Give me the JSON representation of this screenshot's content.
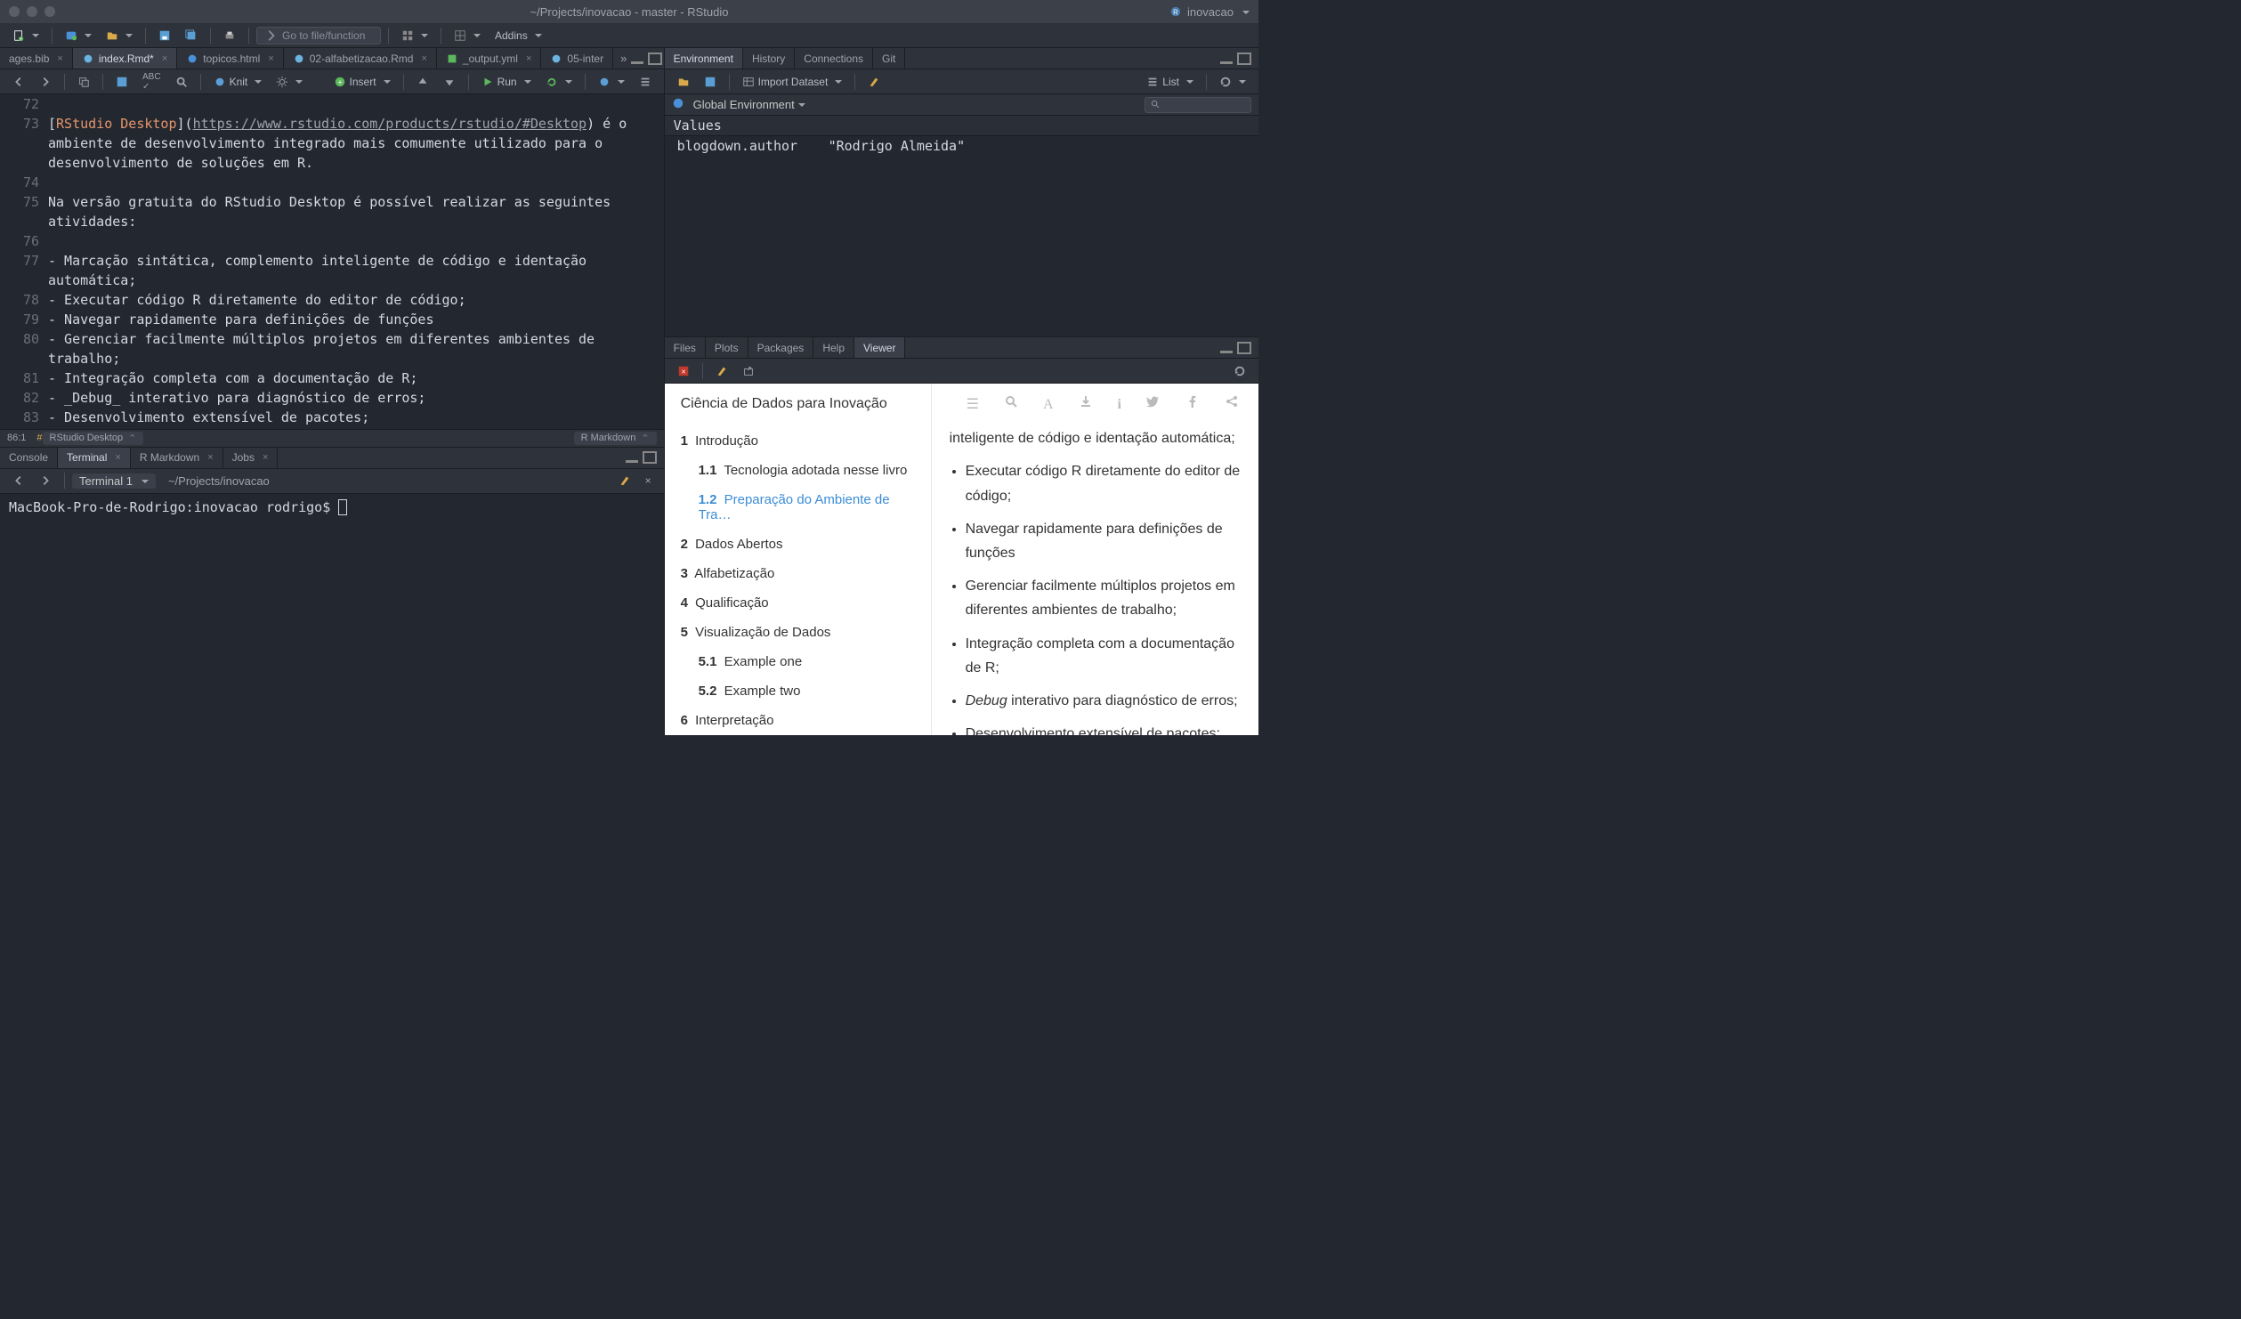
{
  "window": {
    "title": "~/Projects/inovacao - master - RStudio",
    "project": "inovacao"
  },
  "main_toolbar": {
    "goto_placeholder": "Go to file/function",
    "addins": "Addins"
  },
  "source": {
    "tabs": [
      {
        "label": "ages.bib"
      },
      {
        "label": "index.Rmd*"
      },
      {
        "label": "topicos.html"
      },
      {
        "label": "02-alfabetizacao.Rmd"
      },
      {
        "label": "_output.yml"
      },
      {
        "label": "05-inter"
      }
    ],
    "toolbar": {
      "knit": "Knit",
      "insert": "Insert",
      "run": "Run"
    },
    "code": {
      "lines": [
        {
          "n": 72,
          "text": ""
        },
        {
          "n": 73,
          "html": "<span class='tok-br'>[</span><span class='tok-link'>RStudio Desktop</span><span class='tok-br'>](</span><span class='tok-url'>https://www.rstudio.com/products/rstudio/#Desktop</span><span class='tok-br'>)</span> é o ambiente de desenvolvimento integrado mais comumente utilizado para o desenvolvimento de soluções em R."
        },
        {
          "n": 74,
          "text": ""
        },
        {
          "n": 75,
          "text": "Na versão gratuita do RStudio Desktop é possível realizar as seguintes atividades:"
        },
        {
          "n": 76,
          "text": ""
        },
        {
          "n": 77,
          "text": "- Marcação sintática, complemento inteligente de código e identação automática;"
        },
        {
          "n": 78,
          "text": "- Executar código R diretamente do editor de código;"
        },
        {
          "n": 79,
          "text": "- Navegar rapidamente para definições de funções"
        },
        {
          "n": 80,
          "text": "- Gerenciar facilmente múltiplos projetos em diferentes ambientes de trabalho;"
        },
        {
          "n": 81,
          "text": "- Integração completa com a documentação de R;"
        },
        {
          "n": 82,
          "text": "- _Debug_ interativo para diagnóstico de erros;"
        },
        {
          "n": 83,
          "text": "- Desenvolvimento extensível de pacotes;"
        }
      ]
    },
    "status": {
      "pos": "86:1",
      "section": "RStudio Desktop",
      "lang": "R Markdown"
    }
  },
  "console": {
    "tabs": [
      "Console",
      "Terminal",
      "R Markdown",
      "Jobs"
    ],
    "terminal_selector": "Terminal 1",
    "cwd": "~/Projects/inovacao",
    "prompt": "MacBook-Pro-de-Rodrigo:inovacao rodrigo$ "
  },
  "environment": {
    "tabs": [
      "Environment",
      "History",
      "Connections",
      "Git"
    ],
    "import": "Import Dataset",
    "view_mode": "List",
    "scope": "Global Environment",
    "section": "Values",
    "entries": [
      {
        "name": "blogdown.author",
        "value": "\"Rodrigo Almeida\""
      }
    ]
  },
  "viewer": {
    "tabs": [
      "Files",
      "Plots",
      "Packages",
      "Help",
      "Viewer"
    ],
    "book": {
      "title": "Ciência de Dados para Inovação",
      "toc": [
        {
          "num": "1",
          "label": "Introdução",
          "children": [
            {
              "num": "1.1",
              "label": "Tecnologia adotada nesse livro"
            },
            {
              "num": "1.2",
              "label": "Preparação do Ambiente de Tra…",
              "active": true
            }
          ]
        },
        {
          "num": "2",
          "label": "Dados Abertos"
        },
        {
          "num": "3",
          "label": "Alfabetização"
        },
        {
          "num": "4",
          "label": "Qualificação"
        },
        {
          "num": "5",
          "label": "Visualização de Dados",
          "children": [
            {
              "num": "5.1",
              "label": "Example one"
            },
            {
              "num": "5.2",
              "label": "Example two"
            }
          ]
        },
        {
          "num": "6",
          "label": "Interpretação"
        }
      ],
      "content_items": [
        "inteligente de código e identação automática;",
        "Executar código R diretamente do editor de código;",
        "Navegar rapidamente para definições de funções",
        "Gerenciar facilmente múltiplos projetos em diferentes ambientes de trabalho;",
        "Integração completa com a documentação de R;",
        "<em>Debug</em> interativo para diagnóstico de erros;",
        "Desenvolvimento extensível de pacotes;"
      ]
    }
  }
}
